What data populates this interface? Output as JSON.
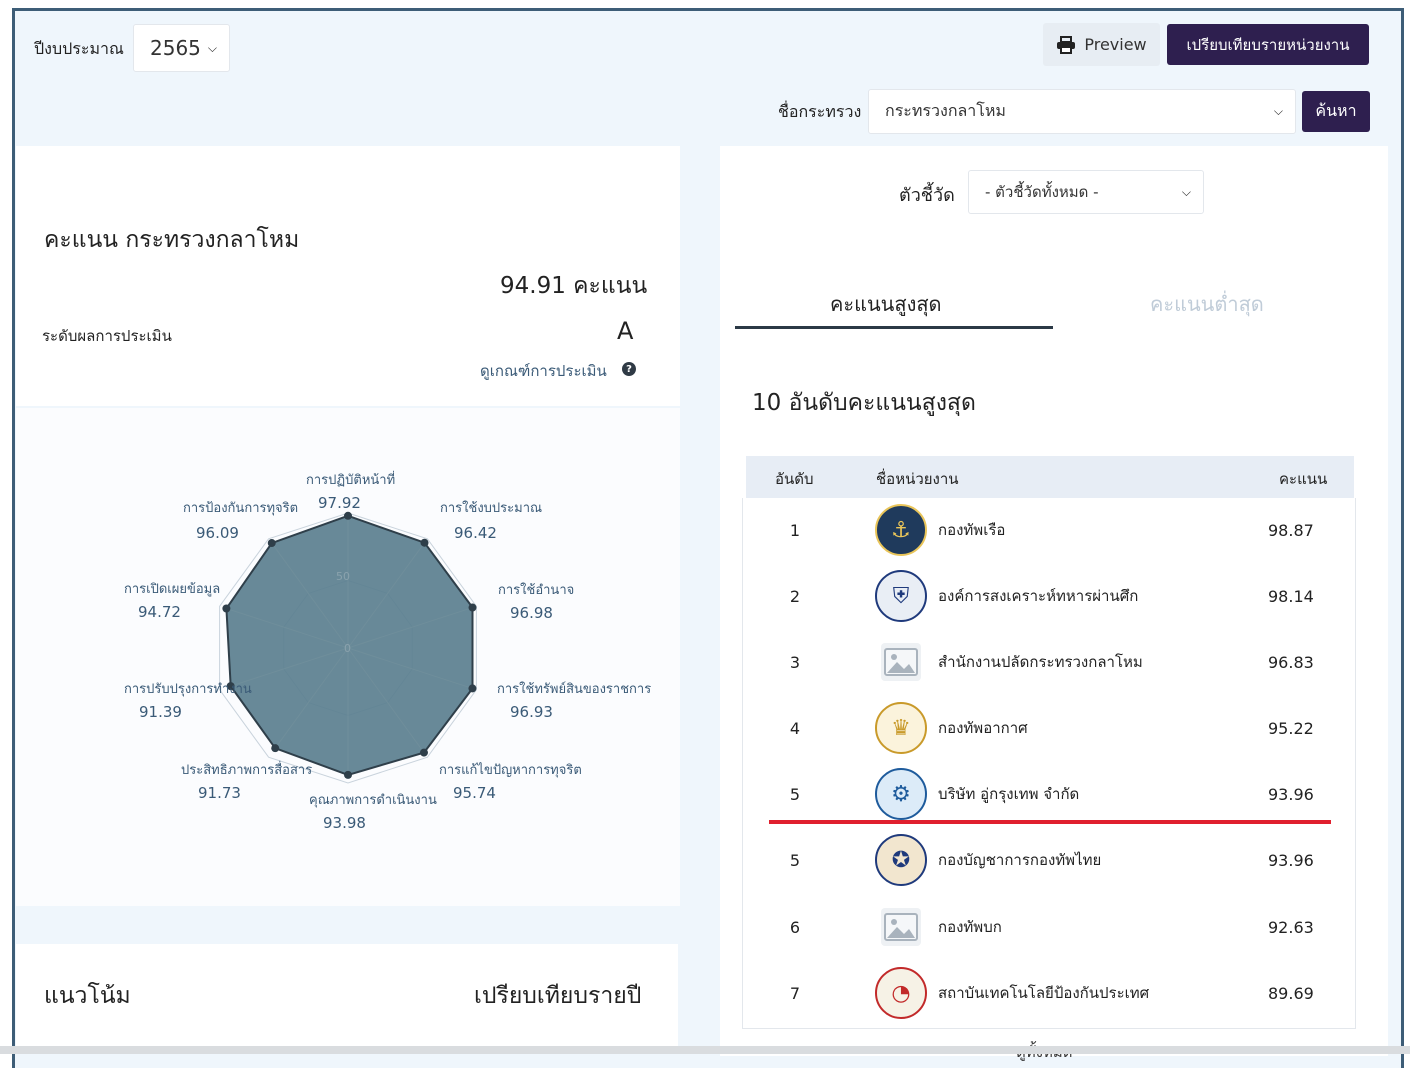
{
  "header": {
    "year_label": "ปีงบประมาณ",
    "year_value": "2565",
    "preview_label": "Preview",
    "compare_units_label": "เปรียบเทียบรายหน่วยงาน",
    "ministry_label": "ชื่อกระทรวง",
    "ministry_value": "กระทรวงกลาโหม",
    "search_label": "ค้นหา"
  },
  "score_card": {
    "title": "คะแนน กระทรวงกลาโหม",
    "score_text": "94.91 คะแนน",
    "level_label": "ระดับผลการประเมิน",
    "level_value": "A",
    "criteria_link": "ดูเกณฑ์การประเมิน",
    "info_icon": "info-icon"
  },
  "radar": {
    "inner_labels": [
      "50",
      "0"
    ],
    "axes": [
      {
        "label": "การปฏิบัติหน้าที่",
        "value": "97.92"
      },
      {
        "label": "การใช้งบประมาณ",
        "value": "96.42"
      },
      {
        "label": "การใช้อำนาจ",
        "value": "96.98"
      },
      {
        "label": "การใช้ทรัพย์สินของราชการ",
        "value": "96.93"
      },
      {
        "label": "การแก้ไขปัญหาการทุจริต",
        "value": "95.74"
      },
      {
        "label": "คุณภาพการดำเนินงาน",
        "value": "93.98"
      },
      {
        "label": "ประสิทธิภาพการสื่อสาร",
        "value": "91.73"
      },
      {
        "label": "การปรับปรุงการทำงาน",
        "value": "91.39"
      },
      {
        "label": "การเปิดเผยข้อมูล",
        "value": "94.72"
      },
      {
        "label": "การป้องกันการทุจริต",
        "value": "96.09"
      }
    ]
  },
  "trend_card": {
    "title": "แนวโน้ม",
    "compare_label": "เปรียบเทียบรายปี"
  },
  "ranking": {
    "indicator_label": "ตัวชี้วัด",
    "indicator_value": "- ตัวชี้วัดทั้งหมด -",
    "tab_high": "คะแนนสูงสุด",
    "tab_low": "คะแนนต่ำสุด",
    "section_title": "10 อันดับคะแนนสูงสุด",
    "col_rank": "อันดับ",
    "col_name": "ชื่อหน่วยงาน",
    "col_score": "คะแนน",
    "rows": [
      {
        "rank": "1",
        "name": "กองทัพเรือ",
        "score": "98.87",
        "icon": "navy-emblem-icon"
      },
      {
        "rank": "2",
        "name": "องค์การสงเคราะห์ทหารผ่านศึก",
        "score": "98.14",
        "icon": "veterans-emblem-icon"
      },
      {
        "rank": "3",
        "name": "สำนักงานปลัดกระทรวงกลาโหม",
        "score": "96.83",
        "icon": "image-placeholder-icon"
      },
      {
        "rank": "4",
        "name": "กองทัพอากาศ",
        "score": "95.22",
        "icon": "airforce-emblem-icon"
      },
      {
        "rank": "5",
        "name": "บริษัท อู่กรุงเทพ จำกัด",
        "score": "93.96",
        "icon": "dockyard-emblem-icon"
      },
      {
        "rank": "5",
        "name": "กองบัญชาการกองทัพไทย",
        "score": "93.96",
        "icon": "armed-forces-emblem-icon"
      },
      {
        "rank": "6",
        "name": "กองทัพบก",
        "score": "92.63",
        "icon": "image-placeholder-icon"
      },
      {
        "rank": "7",
        "name": "สถาบันเทคโนโลยีป้องกันประเทศ",
        "score": "89.69",
        "icon": "dti-emblem-icon"
      }
    ],
    "view_all": "ดูทั้งหมด"
  },
  "colors": {
    "frame": "#3d5d77",
    "background": "#eff6fc",
    "primary_button": "#2e1f4f",
    "radar_fill": "#5b7f8f",
    "radar_text": "#3a5a77",
    "cutoff_line": "#e0202e",
    "tab_inactive": "#c0ccd8"
  }
}
